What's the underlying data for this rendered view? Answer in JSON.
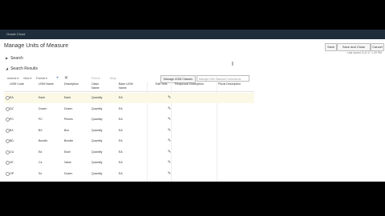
{
  "app": {
    "brand": "Oracle Cloud"
  },
  "page": {
    "title": "Manage Units of Measure",
    "last_saved": "Last saved 11.8.17 1:20 PM"
  },
  "header_buttons": {
    "save": "Save",
    "save_close": "Save and Close",
    "cancel": "Cancel"
  },
  "sections": {
    "search": "Search",
    "results": "Search Results"
  },
  "toolbar": {
    "actions": "Actions ▾",
    "view": "View ▾",
    "format": "Format ▾",
    "add_icon": "plus-icon",
    "delete_icon": "delete-x-icon",
    "freeze": "Freeze",
    "wrap": "Wrap",
    "manage_btn": "Manage UOM Classes",
    "input_placeholder": "Manage UOM Standard Conversions"
  },
  "table": {
    "columns": [
      "UOM Code",
      "UOM Name",
      "Description",
      "Class Name",
      "Base UOM Name",
      "Edit Sets",
      "Reciprocal Description",
      "Plural Description"
    ],
    "rows": [
      [
        "EA",
        "Each",
        "Each",
        "Quantity",
        "EA"
      ],
      [
        "DZ",
        "Dozen",
        "Dozen",
        "Quantity",
        "EA"
      ],
      [
        "PC",
        "PC",
        "Pieces",
        "Quantity",
        "EA"
      ],
      [
        "BX",
        "BX",
        "Box",
        "Quantity",
        "EA"
      ],
      [
        "BD",
        "Bundle",
        "Bundle",
        "Quantity",
        "EA"
      ],
      [
        "CU",
        "Ea",
        "Each",
        "Quantity",
        "EA"
      ],
      [
        "VE",
        "Cs",
        "Value",
        "Quantity",
        "EA"
      ],
      [
        "OP",
        "Sz",
        "Dozen",
        "Quantity",
        "EA"
      ]
    ]
  }
}
